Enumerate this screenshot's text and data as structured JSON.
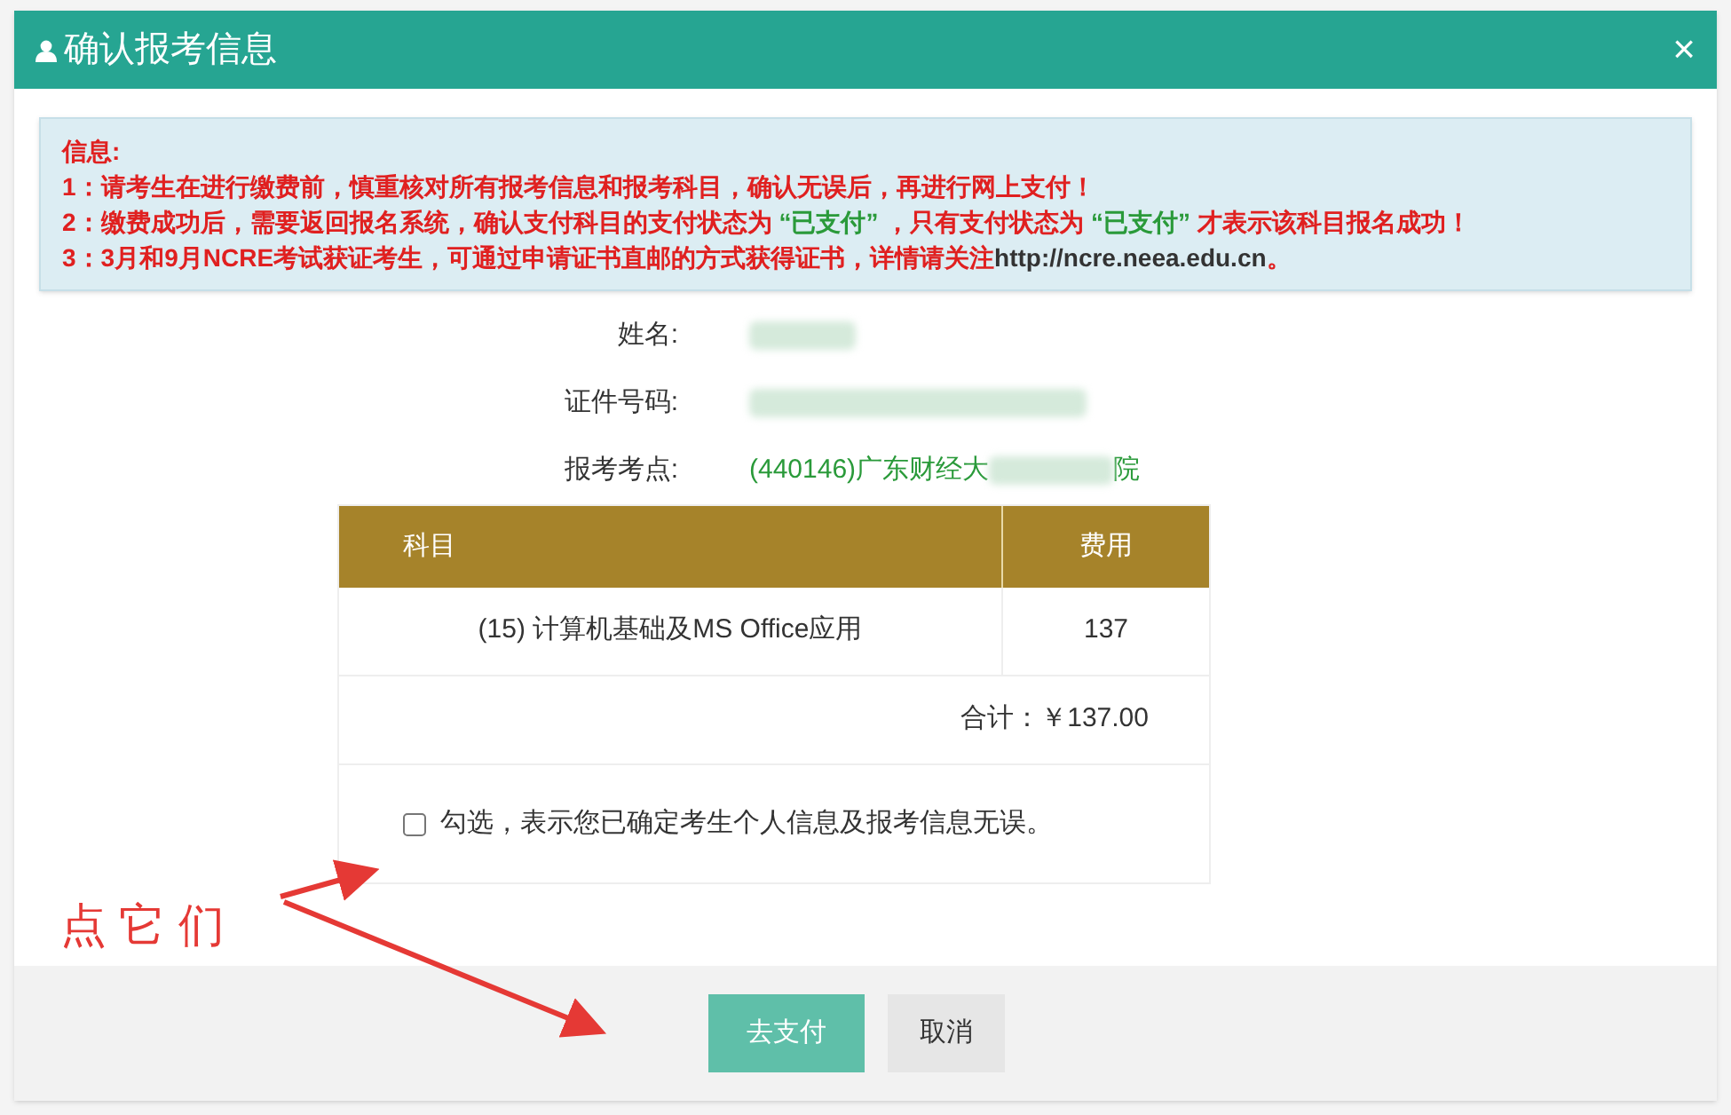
{
  "dialog": {
    "title": "确认报考信息",
    "close": "×"
  },
  "info": {
    "heading": "信息:",
    "lines": [
      [
        {
          "kind": "warn",
          "text": "1：请考生在进行缴费前，慎重核对所有报考信息和报考科目，确认无误后，再进行网上支付！"
        }
      ],
      [
        {
          "kind": "warn",
          "text": "2：缴费成功后，需要返回报名系统，确认支付科目的支付状态为 "
        },
        {
          "kind": "ok",
          "text": "“已支付”"
        },
        {
          "kind": "warn",
          "text": " ，只有支付状态为 "
        },
        {
          "kind": "ok",
          "text": "“已支付”"
        },
        {
          "kind": "warn",
          "text": " 才表示该科目报名成功！"
        }
      ],
      [
        {
          "kind": "warn",
          "text": "3：3月和9月NCRE考试获证考生，可通过申请证书直邮的方式获得证书，详情请关注"
        },
        {
          "kind": "link",
          "text": "http://ncre.neea.edu.cn"
        },
        {
          "kind": "warn",
          "text": "。"
        }
      ]
    ]
  },
  "fields": [
    {
      "label": "姓名:",
      "kind": "redacted"
    },
    {
      "label": "证件号码:",
      "kind": "redacted"
    },
    {
      "label": "报考考点:",
      "kind": "site",
      "value": "(440146)广东财经大",
      "value_end": "院"
    }
  ],
  "table": {
    "columns": [
      "科目",
      "费用"
    ],
    "rows": [
      [
        "(15) 计算机基础及MS Office应用",
        "137"
      ]
    ],
    "total": "合计：￥137.00"
  },
  "confirm": {
    "checked": false,
    "label": "勾选，表示您已确定考生个人信息及报考信息无误。"
  },
  "buttons": [
    {
      "kind": "primary",
      "label": "去支付"
    },
    {
      "kind": "secondary",
      "label": "取消"
    }
  ],
  "annotation": {
    "text": "点 它 们"
  }
}
